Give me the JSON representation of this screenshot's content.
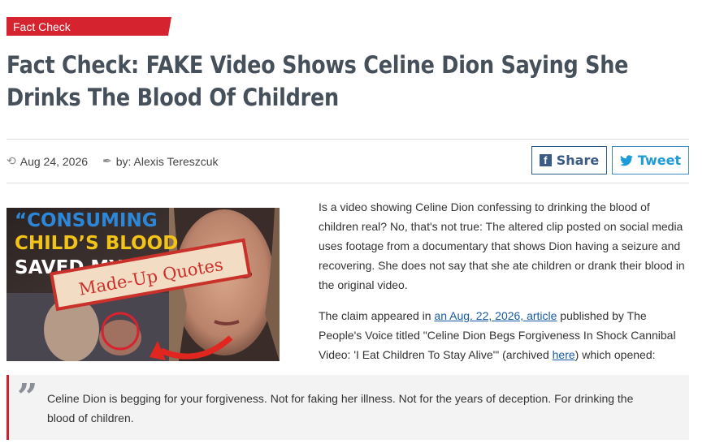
{
  "category": {
    "label": "Fact Check",
    "color": "#d5232f"
  },
  "headline": "Fact Check: FAKE Video Shows Celine Dion Saying She Drinks The Blood Of Children",
  "meta": {
    "date": "Aug 24, 2026",
    "author": "by: Alexis Tereszcuk",
    "date_icon": "clock-history-icon",
    "author_icon": "pen-nib-icon"
  },
  "share": {
    "facebook_label": "Share",
    "twitter_label": "Tweet",
    "facebook_icon": "f",
    "twitter_icon": "twitter-bird-icon"
  },
  "thumbnail": {
    "caption_line1": "“CONSUMING",
    "caption_line2": "CHILD’S BLOOD",
    "caption_line3": "SAVED MY LI",
    "stamp": "Made-Up Quotes"
  },
  "article": {
    "intro": "Is a video showing Celine Dion confessing to drinking the blood of children real? No, that's not true: The altered clip posted on social media uses footage from a documentary that shows Dion having a seizure and recovering. She does not say that she ate children or drank their blood in the original video.",
    "claim_pre": "The claim appeared in ",
    "claim_link": "an Aug. 22, 2026, article",
    "claim_mid": " published by The People's Voice titled \"Celine Dion Begs Forgiveness In Shock Cannibal Video: 'I Eat Children To Stay Alive'\" (archived ",
    "archive_link": "here",
    "claim_post": ") which opened:"
  },
  "quote": {
    "mark": "”",
    "text": "Celine Dion is begging for your forgiveness. Not for faking her illness. Not for the years of deception. For drinking the blood of children."
  }
}
